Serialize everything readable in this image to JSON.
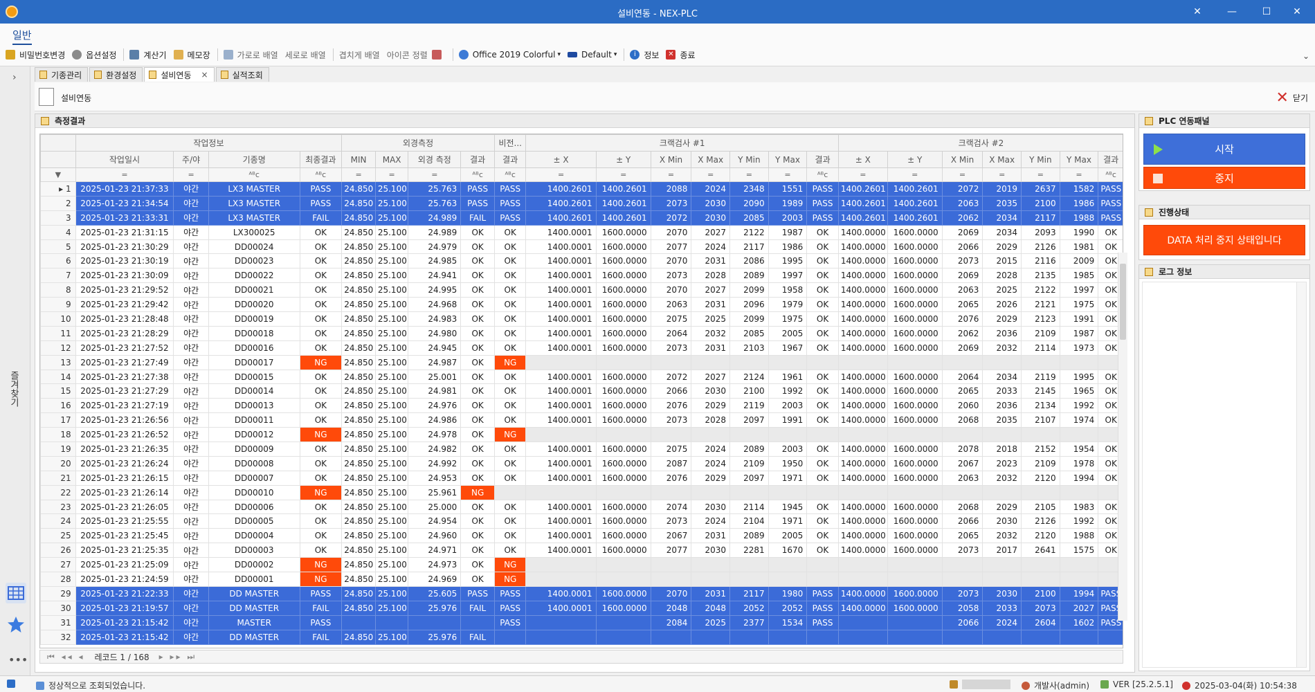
{
  "window": {
    "title": "설비연동 - NEX-PLC"
  },
  "ribbon": {
    "tab": "일반",
    "buttons": [
      "비밀번호변경",
      "옵션설정",
      "계산기",
      "메모장",
      "가로로 배열",
      "세로로 배열",
      "겹치게 배열",
      "아이콘 정렬"
    ],
    "theme": "Office 2019 Colorful",
    "palette": "Default",
    "info": "정보",
    "exit": "종료"
  },
  "sidebar": {
    "label": "즐겨찾기"
  },
  "tabs": [
    {
      "label": "기종관리",
      "active": false
    },
    {
      "label": "환경설정",
      "active": false
    },
    {
      "label": "설비연동",
      "active": true
    },
    {
      "label": "실적조회",
      "active": false
    }
  ],
  "page": {
    "title": "설비연동",
    "close_label": "닫기",
    "panel_title": "측정결과"
  },
  "grid": {
    "bands": [
      "작업정보",
      "외경측정",
      "비전...",
      "크랙검사 #1",
      "크랙검사 #2"
    ],
    "columns": [
      "작업일시",
      "주/야",
      "기종명",
      "최종결과",
      "MIN",
      "MAX",
      "외경 측정",
      "결과",
      "결과",
      "± X",
      "± Y",
      "X Min",
      "X Max",
      "Y Min",
      "Y Max",
      "결과",
      "± X",
      "± Y",
      "X Min",
      "X Max",
      "Y Min",
      "Y Max",
      "결과"
    ],
    "rows": [
      {
        "sel": true,
        "c": [
          "2025-01-23 21:37:33",
          "야간",
          "LX3 MASTER",
          "PASS",
          "24.850",
          "25.100",
          "25.763",
          "PASS",
          "PASS",
          "1400.2601",
          "1400.2601",
          "2088",
          "2024",
          "2348",
          "1551",
          "PASS",
          "1400.2601",
          "1400.2601",
          "2072",
          "2019",
          "2637",
          "1582",
          "PASS"
        ]
      },
      {
        "sel": true,
        "c": [
          "2025-01-23 21:34:54",
          "야간",
          "LX3 MASTER",
          "PASS",
          "24.850",
          "25.100",
          "25.763",
          "PASS",
          "PASS",
          "1400.2601",
          "1400.2601",
          "2073",
          "2030",
          "2090",
          "1989",
          "PASS",
          "1400.2601",
          "1400.2601",
          "2063",
          "2035",
          "2100",
          "1986",
          "PASS"
        ]
      },
      {
        "sel": true,
        "c": [
          "2025-01-23 21:33:31",
          "야간",
          "LX3 MASTER",
          "FAIL",
          "24.850",
          "25.100",
          "24.989",
          "FAIL",
          "PASS",
          "1400.2601",
          "1400.2601",
          "2072",
          "2030",
          "2085",
          "2003",
          "PASS",
          "1400.2601",
          "1400.2601",
          "2062",
          "2034",
          "2117",
          "1988",
          "PASS"
        ]
      },
      {
        "c": [
          "2025-01-23 21:31:15",
          "야간",
          "LX300025",
          "OK",
          "24.850",
          "25.100",
          "24.989",
          "OK",
          "OK",
          "1400.0001",
          "1600.0000",
          "2070",
          "2027",
          "2122",
          "1987",
          "OK",
          "1400.0000",
          "1600.0000",
          "2069",
          "2034",
          "2093",
          "1990",
          "OK"
        ]
      },
      {
        "c": [
          "2025-01-23 21:30:29",
          "야간",
          "DD00024",
          "OK",
          "24.850",
          "25.100",
          "24.979",
          "OK",
          "OK",
          "1400.0001",
          "1600.0000",
          "2077",
          "2024",
          "2117",
          "1986",
          "OK",
          "1400.0000",
          "1600.0000",
          "2066",
          "2029",
          "2126",
          "1981",
          "OK"
        ]
      },
      {
        "c": [
          "2025-01-23 21:30:19",
          "야간",
          "DD00023",
          "OK",
          "24.850",
          "25.100",
          "24.985",
          "OK",
          "OK",
          "1400.0001",
          "1600.0000",
          "2070",
          "2031",
          "2086",
          "1995",
          "OK",
          "1400.0000",
          "1600.0000",
          "2073",
          "2015",
          "2116",
          "2009",
          "OK"
        ]
      },
      {
        "c": [
          "2025-01-23 21:30:09",
          "야간",
          "DD00022",
          "OK",
          "24.850",
          "25.100",
          "24.941",
          "OK",
          "OK",
          "1400.0001",
          "1600.0000",
          "2073",
          "2028",
          "2089",
          "1997",
          "OK",
          "1400.0000",
          "1600.0000",
          "2069",
          "2028",
          "2135",
          "1985",
          "OK"
        ]
      },
      {
        "c": [
          "2025-01-23 21:29:52",
          "야간",
          "DD00021",
          "OK",
          "24.850",
          "25.100",
          "24.995",
          "OK",
          "OK",
          "1400.0001",
          "1600.0000",
          "2070",
          "2027",
          "2099",
          "1958",
          "OK",
          "1400.0000",
          "1600.0000",
          "2063",
          "2025",
          "2122",
          "1997",
          "OK"
        ]
      },
      {
        "c": [
          "2025-01-23 21:29:42",
          "야간",
          "DD00020",
          "OK",
          "24.850",
          "25.100",
          "24.968",
          "OK",
          "OK",
          "1400.0001",
          "1600.0000",
          "2063",
          "2031",
          "2096",
          "1979",
          "OK",
          "1400.0000",
          "1600.0000",
          "2065",
          "2026",
          "2121",
          "1975",
          "OK"
        ]
      },
      {
        "c": [
          "2025-01-23 21:28:48",
          "야간",
          "DD00019",
          "OK",
          "24.850",
          "25.100",
          "24.983",
          "OK",
          "OK",
          "1400.0001",
          "1600.0000",
          "2075",
          "2025",
          "2099",
          "1975",
          "OK",
          "1400.0000",
          "1600.0000",
          "2076",
          "2029",
          "2123",
          "1991",
          "OK"
        ]
      },
      {
        "c": [
          "2025-01-23 21:28:29",
          "야간",
          "DD00018",
          "OK",
          "24.850",
          "25.100",
          "24.980",
          "OK",
          "OK",
          "1400.0001",
          "1600.0000",
          "2064",
          "2032",
          "2085",
          "2005",
          "OK",
          "1400.0000",
          "1600.0000",
          "2062",
          "2036",
          "2109",
          "1987",
          "OK"
        ]
      },
      {
        "c": [
          "2025-01-23 21:27:52",
          "야간",
          "DD00016",
          "OK",
          "24.850",
          "25.100",
          "24.945",
          "OK",
          "OK",
          "1400.0001",
          "1600.0000",
          "2073",
          "2031",
          "2103",
          "1967",
          "OK",
          "1400.0000",
          "1600.0000",
          "2069",
          "2032",
          "2114",
          "1973",
          "OK"
        ]
      },
      {
        "c": [
          "2025-01-23 21:27:49",
          "야간",
          "DD00017",
          "NG",
          "24.850",
          "25.100",
          "24.987",
          "OK",
          "NG",
          "",
          "",
          "",
          "",
          "",
          "",
          "",
          "",
          "",
          "",
          "",
          "",
          "",
          ""
        ]
      },
      {
        "c": [
          "2025-01-23 21:27:38",
          "야간",
          "DD00015",
          "OK",
          "24.850",
          "25.100",
          "25.001",
          "OK",
          "OK",
          "1400.0001",
          "1600.0000",
          "2072",
          "2027",
          "2124",
          "1961",
          "OK",
          "1400.0000",
          "1600.0000",
          "2064",
          "2034",
          "2119",
          "1995",
          "OK"
        ]
      },
      {
        "c": [
          "2025-01-23 21:27:29",
          "야간",
          "DD00014",
          "OK",
          "24.850",
          "25.100",
          "24.981",
          "OK",
          "OK",
          "1400.0001",
          "1600.0000",
          "2066",
          "2030",
          "2100",
          "1992",
          "OK",
          "1400.0000",
          "1600.0000",
          "2065",
          "2033",
          "2145",
          "1965",
          "OK"
        ]
      },
      {
        "c": [
          "2025-01-23 21:27:19",
          "야간",
          "DD00013",
          "OK",
          "24.850",
          "25.100",
          "24.976",
          "OK",
          "OK",
          "1400.0001",
          "1600.0000",
          "2076",
          "2029",
          "2119",
          "2003",
          "OK",
          "1400.0000",
          "1600.0000",
          "2060",
          "2036",
          "2134",
          "1992",
          "OK"
        ]
      },
      {
        "c": [
          "2025-01-23 21:26:56",
          "야간",
          "DD00011",
          "OK",
          "24.850",
          "25.100",
          "24.986",
          "OK",
          "OK",
          "1400.0001",
          "1600.0000",
          "2073",
          "2028",
          "2097",
          "1991",
          "OK",
          "1400.0000",
          "1600.0000",
          "2068",
          "2035",
          "2107",
          "1974",
          "OK"
        ]
      },
      {
        "c": [
          "2025-01-23 21:26:52",
          "야간",
          "DD00012",
          "NG",
          "24.850",
          "25.100",
          "24.978",
          "OK",
          "NG",
          "",
          "",
          "",
          "",
          "",
          "",
          "",
          "",
          "",
          "",
          "",
          "",
          "",
          ""
        ]
      },
      {
        "c": [
          "2025-01-23 21:26:35",
          "야간",
          "DD00009",
          "OK",
          "24.850",
          "25.100",
          "24.982",
          "OK",
          "OK",
          "1400.0001",
          "1600.0000",
          "2075",
          "2024",
          "2089",
          "2003",
          "OK",
          "1400.0000",
          "1600.0000",
          "2078",
          "2018",
          "2152",
          "1954",
          "OK"
        ]
      },
      {
        "c": [
          "2025-01-23 21:26:24",
          "야간",
          "DD00008",
          "OK",
          "24.850",
          "25.100",
          "24.992",
          "OK",
          "OK",
          "1400.0001",
          "1600.0000",
          "2087",
          "2024",
          "2109",
          "1950",
          "OK",
          "1400.0000",
          "1600.0000",
          "2067",
          "2023",
          "2109",
          "1978",
          "OK"
        ]
      },
      {
        "c": [
          "2025-01-23 21:26:15",
          "야간",
          "DD00007",
          "OK",
          "24.850",
          "25.100",
          "24.953",
          "OK",
          "OK",
          "1400.0001",
          "1600.0000",
          "2076",
          "2029",
          "2097",
          "1971",
          "OK",
          "1400.0000",
          "1600.0000",
          "2063",
          "2032",
          "2120",
          "1994",
          "OK"
        ]
      },
      {
        "c": [
          "2025-01-23 21:26:14",
          "야간",
          "DD00010",
          "NG",
          "24.850",
          "25.100",
          "25.961",
          "NG",
          "",
          "",
          "",
          "",
          "",
          "",
          "",
          "",
          "",
          "",
          "",
          "",
          "",
          "",
          ""
        ]
      },
      {
        "c": [
          "2025-01-23 21:26:05",
          "야간",
          "DD00006",
          "OK",
          "24.850",
          "25.100",
          "25.000",
          "OK",
          "OK",
          "1400.0001",
          "1600.0000",
          "2074",
          "2030",
          "2114",
          "1945",
          "OK",
          "1400.0000",
          "1600.0000",
          "2068",
          "2029",
          "2105",
          "1983",
          "OK"
        ]
      },
      {
        "c": [
          "2025-01-23 21:25:55",
          "야간",
          "DD00005",
          "OK",
          "24.850",
          "25.100",
          "24.954",
          "OK",
          "OK",
          "1400.0001",
          "1600.0000",
          "2073",
          "2024",
          "2104",
          "1971",
          "OK",
          "1400.0000",
          "1600.0000",
          "2066",
          "2030",
          "2126",
          "1992",
          "OK"
        ]
      },
      {
        "c": [
          "2025-01-23 21:25:45",
          "야간",
          "DD00004",
          "OK",
          "24.850",
          "25.100",
          "24.960",
          "OK",
          "OK",
          "1400.0001",
          "1600.0000",
          "2067",
          "2031",
          "2089",
          "2005",
          "OK",
          "1400.0000",
          "1600.0000",
          "2065",
          "2032",
          "2120",
          "1988",
          "OK"
        ]
      },
      {
        "c": [
          "2025-01-23 21:25:35",
          "야간",
          "DD00003",
          "OK",
          "24.850",
          "25.100",
          "24.971",
          "OK",
          "OK",
          "1400.0001",
          "1600.0000",
          "2077",
          "2030",
          "2281",
          "1670",
          "OK",
          "1400.0000",
          "1600.0000",
          "2073",
          "2017",
          "2641",
          "1575",
          "OK"
        ]
      },
      {
        "c": [
          "2025-01-23 21:25:09",
          "야간",
          "DD00002",
          "NG",
          "24.850",
          "25.100",
          "24.973",
          "OK",
          "NG",
          "",
          "",
          "",
          "",
          "",
          "",
          "",
          "",
          "",
          "",
          "",
          "",
          "",
          ""
        ]
      },
      {
        "c": [
          "2025-01-23 21:24:59",
          "야간",
          "DD00001",
          "NG",
          "24.850",
          "25.100",
          "24.969",
          "OK",
          "NG",
          "",
          "",
          "",
          "",
          "",
          "",
          "",
          "",
          "",
          "",
          "",
          "",
          "",
          ""
        ]
      },
      {
        "sel": true,
        "c": [
          "2025-01-23 21:22:33",
          "야간",
          "DD MASTER",
          "PASS",
          "24.850",
          "25.100",
          "25.605",
          "PASS",
          "PASS",
          "1400.0001",
          "1600.0000",
          "2070",
          "2031",
          "2117",
          "1980",
          "PASS",
          "1400.0000",
          "1600.0000",
          "2073",
          "2030",
          "2100",
          "1994",
          "PASS"
        ]
      },
      {
        "sel": true,
        "c": [
          "2025-01-23 21:19:57",
          "야간",
          "DD MASTER",
          "FAIL",
          "24.850",
          "25.100",
          "25.976",
          "FAIL",
          "PASS",
          "1400.0001",
          "1600.0000",
          "2048",
          "2048",
          "2052",
          "2052",
          "PASS",
          "1400.0000",
          "1600.0000",
          "2058",
          "2033",
          "2073",
          "2027",
          "PASS"
        ]
      },
      {
        "sel": true,
        "c": [
          "2025-01-23 21:15:42",
          "야간",
          "MASTER",
          "PASS",
          "",
          "",
          "",
          "",
          "PASS",
          "",
          "",
          "2084",
          "2025",
          "2377",
          "1534",
          "PASS",
          "",
          "",
          "2066",
          "2024",
          "2604",
          "1602",
          "PASS"
        ]
      },
      {
        "sel": true,
        "c": [
          "2025-01-23 21:15:42",
          "야간",
          "DD MASTER",
          "FAIL",
          "24.850",
          "25.100",
          "25.976",
          "FAIL",
          "",
          "",
          "",
          "",
          "",
          "",
          "",
          "",
          "",
          "",
          "",
          "",
          "",
          "",
          ""
        ]
      }
    ],
    "footer": "레코드 1 / 168"
  },
  "plc": {
    "title": "PLC 연동패널",
    "start": "시작",
    "stop": "중지",
    "status_title": "진행상태",
    "status_text": "DATA 처리 중지 상태입니다",
    "log_title": "로그 정보"
  },
  "status": {
    "message": "정상적으로 조회되었습니다.",
    "user": "개발사(admin)",
    "version": "VER [25.2.5.1]",
    "datetime": "2025-03-04(화) 10:54:38"
  },
  "colors": {
    "accent": "#2b6cc4",
    "selected_row": "#3b6bd8",
    "ng": "#ff4a0a",
    "start": "#3e6fd9"
  }
}
